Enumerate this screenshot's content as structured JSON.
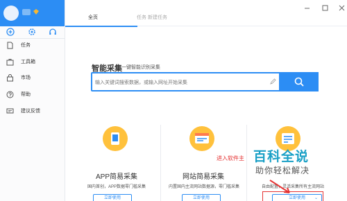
{
  "sidebar": {
    "nav": [
      {
        "label": "任务",
        "icon": "document-icon"
      },
      {
        "label": "工具箱",
        "icon": "toolbox-icon"
      },
      {
        "label": "市场",
        "icon": "shopping-bag-icon"
      },
      {
        "label": "帮助",
        "icon": "help-icon"
      },
      {
        "label": "建议反馈",
        "icon": "feedback-icon"
      }
    ]
  },
  "tabs": [
    {
      "label": "全页",
      "active": true
    },
    {
      "label": "任务  新建任务",
      "active": false
    }
  ],
  "collect": {
    "title": "智能采集",
    "subtitle": "一键智能识别采集",
    "placeholder": "输入关键词搜索数据，或输入网址开始采集"
  },
  "cards": [
    {
      "title": "APP简易采集",
      "desc": "国内首创，APP数据零门槛采集",
      "button": "立即使用"
    },
    {
      "title": "网站简易采集",
      "desc": "内置国内主流网站数据源，零门槛采集",
      "button": "立即使用"
    },
    {
      "title": "",
      "desc": "自由配置，灵活采集所有主流网站",
      "button": "立即使用"
    }
  ],
  "annotation": "进入软件主",
  "watermark": {
    "main": "百科全说",
    "sub": "助你轻松解决"
  },
  "colors": {
    "accent": "#2c8df4",
    "annotation": "#e53333",
    "watermark": "#1aa0c6"
  }
}
